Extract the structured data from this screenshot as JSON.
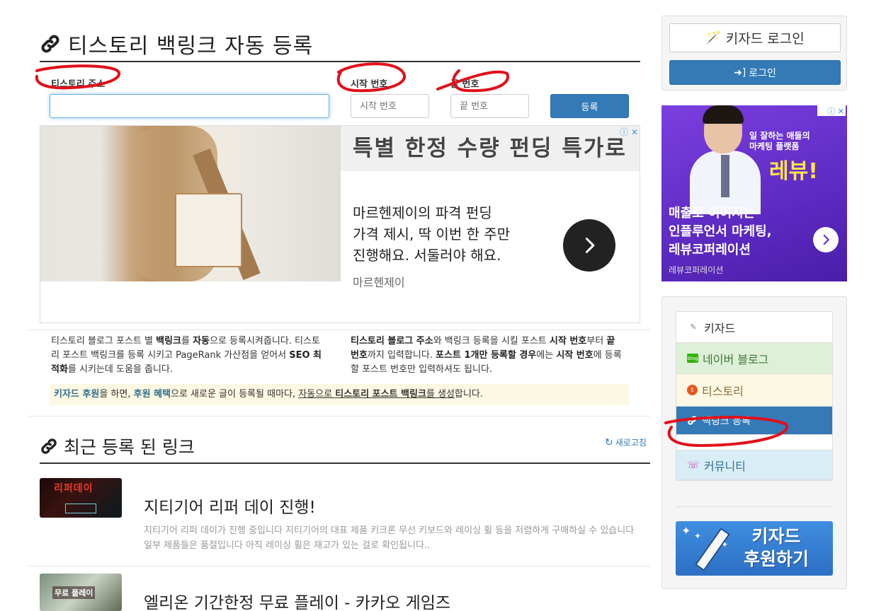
{
  "main": {
    "title": "티스토리 백링크 자동 등록",
    "form": {
      "address_label": "티스토리 주소",
      "address_value": "",
      "start_label": "시작 번호",
      "start_placeholder": "시작 번호",
      "end_label": "끝 번호",
      "end_placeholder": "끝 번호",
      "submit_label": "등록"
    },
    "ad": {
      "headline": "특별 한정 수량 펀딩 특가로",
      "body_line1": "마르헨제이의 파격 펀딩",
      "body_line2": "가격 제시, 딱 이번 한 주만",
      "body_line3": "진행해요. 서둘러야 해요.",
      "brand": "마르헨제이",
      "badge": "ⓘ ✕"
    },
    "info_left": {
      "p1": "티스토리 블로그 포스트 별 ",
      "b1": "백링크",
      "p2": "를 ",
      "b2": "자동",
      "p3": "으로 등록시켜줍니다. 티스토리 포스트 백링크를 등록 시키고 PageRank 가산점을 얻어서 ",
      "b3": "SEO 최적화",
      "p4": "를 시키는데 도움을 줍니다."
    },
    "info_right": {
      "b1": "티스토리 블로그 주소",
      "p1": "와 백링크 등록을 시킬 포스트 ",
      "b2": "시작 번호",
      "p2": "부터 ",
      "b3": "끝 번호",
      "p3": "까지 입력합니다. ",
      "b4": "포스트 1개만 등록할 경우",
      "p4": "에는 ",
      "b5": "시작 번호",
      "p5": "에 등록할 포스트 번호만 입력하셔도 됩니다."
    },
    "notice": {
      "a": "키자드 후원",
      "b": "을 하면, ",
      "c": "후원 혜택",
      "d": "으로 새로운 글이 등록될 때마다, ",
      "e1": "자동으로 ",
      "e2": "티스토리 포스트 백링크",
      "e3": "를 생성",
      "f": "합니다."
    },
    "recent": {
      "title": "최근 등록 된 링크",
      "refresh": "새로고침",
      "items": [
        {
          "thumb_text": "리퍼데이",
          "title": "지티기어 리퍼 데이 진행!",
          "desc": "지티기어 리퍼 데이가 진행 중입니다 지티기어의 대표 제품 키크론 무선 키보드와 레이싱 휠 등을 저렴하게 구매하실 수 있습니다 일부 제품들은 품절입니다 아직 레이싱 휠은 재고가 있는 걸로 확인됩니다.."
        },
        {
          "thumb_text": "무료 플레이",
          "title": "엘리온 기간한정 무료 플레이 - 카카오 게임즈",
          "desc": ""
        }
      ]
    }
  },
  "sidebar": {
    "kizard_login": "키자드 로그인",
    "login": "로그인",
    "ad": {
      "small": "일 잘하는 애들의\n마케팅 플랫폼",
      "big": "레뷰!",
      "copy_line1": "매출로 이어지는",
      "copy_line2": "인플루언서 마케팅,",
      "copy_line3": "레뷰코퍼레이션",
      "brand": "레뷰코퍼레이션",
      "badge": "ⓘ ✕"
    },
    "nav": [
      {
        "label": "키자드"
      },
      {
        "label": "네이버 블로그"
      },
      {
        "label": "티스토리"
      },
      {
        "label": "백링크 등록"
      },
      {
        "label": "커뮤니티"
      }
    ],
    "donate": "키자드\n후원하기"
  },
  "colors": {
    "primary": "#337ab7",
    "annotation": "#e0101a",
    "naver_bg": "#dff0d8",
    "tistory_bg": "#fcf8e3",
    "community_bg": "#d9edf7",
    "notice_bg": "#fcf8e3"
  }
}
